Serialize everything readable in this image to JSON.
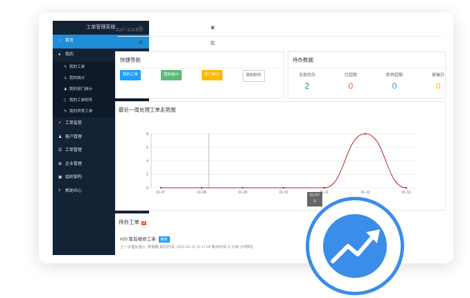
{
  "sidebar": {
    "brand": "工单管理系统",
    "home": "首页",
    "mine": "我的",
    "mine_items": [
      "我的工单",
      "我的统计",
      "我的部门统计",
      "我的工单附件",
      "我的异常工单"
    ],
    "menus": [
      "工单监管",
      "客户管理",
      "工单管理",
      "企业管理",
      "组织架构",
      "帮助中心"
    ]
  },
  "topbar": {
    "company": "广西大汽源网络科技有限公司",
    "action": "发起工单"
  },
  "breadcrumb": "后台 / 后台首页",
  "quick_nav": {
    "title": "快捷导航",
    "buttons": [
      {
        "label": "我的工单",
        "color": "#1e9fff"
      },
      {
        "label": "我的统计",
        "color": "#5fb878"
      },
      {
        "label": "部门统计",
        "color": "#ffb800"
      },
      {
        "label": "我的附件",
        "color": "#ffffff"
      }
    ]
  },
  "pending": {
    "title": "待办数据",
    "stats": [
      {
        "label": "全部待办",
        "value": "2",
        "color": "#009688"
      },
      {
        "label": "已超期",
        "value": "0",
        "color": "#ff5722"
      },
      {
        "label": "即将超期",
        "value": "0",
        "color": "#1e9fff"
      },
      {
        "label": "被催办",
        "value": "0",
        "color": "#ffb800"
      }
    ]
  },
  "chart_title": "最近一周处理工单走势图",
  "chart_data": {
    "type": "line",
    "x": [
      "01-07",
      "01-08",
      "01-09",
      "01-10",
      "01-11",
      "01-12",
      "01-13"
    ],
    "values": [
      0,
      0,
      0,
      0,
      0,
      8,
      0
    ],
    "ylim": [
      0,
      8
    ],
    "yticks": [
      0,
      2,
      4,
      6,
      8
    ],
    "series_color": "#b22222",
    "tooltip": {
      "x": "01-07",
      "value": "0"
    }
  },
  "todo": {
    "title": "待办工单",
    "count": "2",
    "ticket": {
      "title": "#20  售后维修工单",
      "tag": "精单",
      "meta": "上一步理处理人: 廖振鹏       到达时间: 2021-01-12 15 17:04       剩余时间: 0 分钟   (不限时)"
    }
  }
}
